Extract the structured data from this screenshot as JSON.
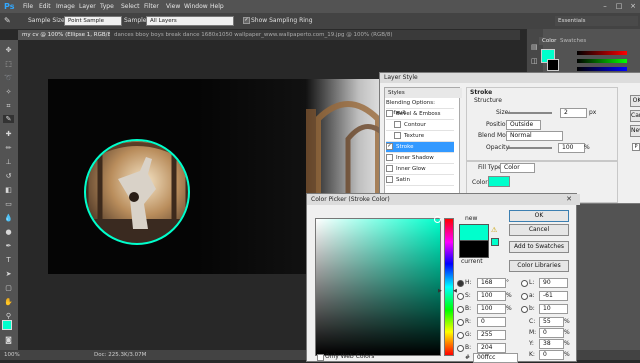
{
  "menubar": {
    "logo": "Ps",
    "items": [
      "File",
      "Edit",
      "Image",
      "Layer",
      "Type",
      "Select",
      "Filter",
      "View",
      "Window",
      "Help"
    ],
    "window_controls": [
      "–",
      "□",
      "×"
    ]
  },
  "options": {
    "sample_size_label": "Sample Size:",
    "sample_size_value": "Point Sample",
    "sample_label": "Sample:",
    "sample_value": "All Layers",
    "show_ring_label": "Show Sampling Ring",
    "workspace": "Essentials"
  },
  "tabs": {
    "active": "my cv @ 100% (Ellipse 1, RGB/8) *",
    "inactive": "dances bboy boys break dance 1680x1050 wallpaper_www.wallpaperto.com_19.jpg @ 100% (RGB/8)"
  },
  "status": {
    "zoom": "100%",
    "doc": "Doc: 225.3K/3.07M"
  },
  "panels": {
    "color_tab": "Color",
    "swatches_tab": "Swatches"
  },
  "layer_style": {
    "title": "Layer Style",
    "sidebar_header": "Styles",
    "items": [
      {
        "label": "Blending Options: Default",
        "check": false,
        "selected": false
      },
      {
        "label": "Bevel & Emboss",
        "check": true,
        "selected": false
      },
      {
        "label": "Contour",
        "check": true,
        "selected": false
      },
      {
        "label": "Texture",
        "check": true,
        "selected": false
      },
      {
        "label": "Stroke",
        "check": true,
        "selected": true
      },
      {
        "label": "Inner Shadow",
        "check": true,
        "selected": false
      },
      {
        "label": "Inner Glow",
        "check": true,
        "selected": false
      },
      {
        "label": "Satin",
        "check": true,
        "selected": false
      }
    ],
    "section": "Stroke",
    "structure": "Structure",
    "size_label": "Size:",
    "size_value": "2",
    "size_unit": "px",
    "position_label": "Position:",
    "position_value": "Outside",
    "blend_label": "Blend Mode:",
    "blend_value": "Normal",
    "opacity_label": "Opacity:",
    "opacity_value": "100",
    "opacity_unit": "%",
    "fill_type_label": "Fill Type:",
    "fill_type_value": "Color",
    "color_label": "Color:",
    "stroke_color": "#00ffcc",
    "right_buttons": [
      "OK",
      "Cancel",
      "New",
      "P"
    ]
  },
  "color_picker": {
    "title": "Color Picker (Stroke Color)",
    "new_label": "new",
    "current_label": "current",
    "new_color": "#00ffcc",
    "current_color": "#000000",
    "ok": "OK",
    "cancel": "Cancel",
    "add_swatches": "Add to Swatches",
    "color_libraries": "Color Libraries",
    "only_web": "Only Web Colors",
    "hsb": [
      {
        "label": "H:",
        "value": "168",
        "unit": "°",
        "radio": true
      },
      {
        "label": "S:",
        "value": "100",
        "unit": "%",
        "radio": false
      },
      {
        "label": "B:",
        "value": "100",
        "unit": "%",
        "radio": false
      }
    ],
    "rgb": [
      {
        "label": "R:",
        "value": "0"
      },
      {
        "label": "G:",
        "value": "255"
      },
      {
        "label": "B:",
        "value": "204"
      }
    ],
    "lab": [
      {
        "label": "L:",
        "value": "90"
      },
      {
        "label": "a:",
        "value": "-61"
      },
      {
        "label": "b:",
        "value": "10"
      }
    ],
    "cmyk": [
      {
        "label": "C:",
        "value": "55",
        "unit": "%"
      },
      {
        "label": "M:",
        "value": "0",
        "unit": "%"
      },
      {
        "label": "Y:",
        "value": "38",
        "unit": "%"
      },
      {
        "label": "K:",
        "value": "0",
        "unit": "%"
      }
    ],
    "hex_label": "#",
    "hex": "00ffcc"
  },
  "colors": {
    "accent": "#00ffcc",
    "ps_blue": "#31a8ff",
    "selected_blue": "#3399ff"
  }
}
